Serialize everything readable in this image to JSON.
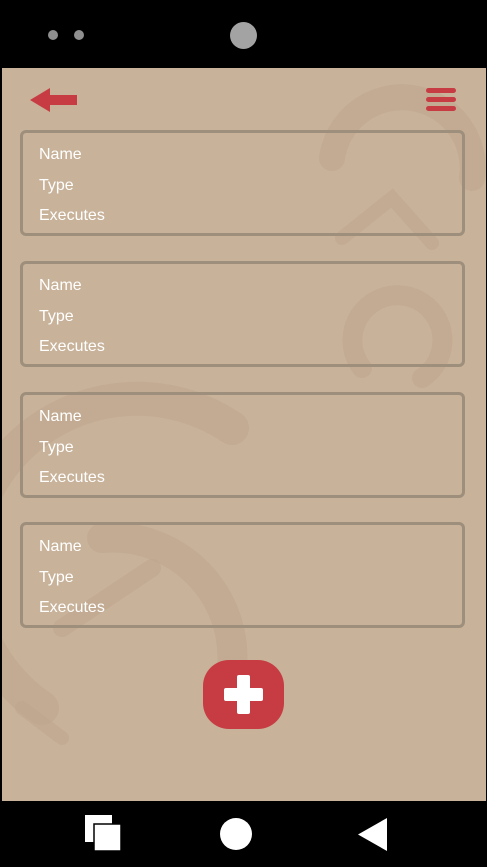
{
  "header": {
    "back_icon": "arrow-left-icon",
    "menu_icon": "hamburger-menu-icon"
  },
  "cards": [
    {
      "name_label": "Name",
      "type_label": "Type",
      "executes_label": "Executes"
    },
    {
      "name_label": "Name",
      "type_label": "Type",
      "executes_label": "Executes"
    },
    {
      "name_label": "Name",
      "type_label": "Type",
      "executes_label": "Executes"
    },
    {
      "name_label": "Name",
      "type_label": "Type",
      "executes_label": "Executes"
    }
  ],
  "fab": {
    "icon": "plus-icon"
  },
  "nav": {
    "recents_icon": "recents-square-icon",
    "home_icon": "home-circle-icon",
    "back_icon": "back-triangle-icon"
  },
  "colors": {
    "background": "#c8b299",
    "accent": "#c73c42",
    "card_border": "#9e8f7d",
    "text": "#ffffff"
  }
}
